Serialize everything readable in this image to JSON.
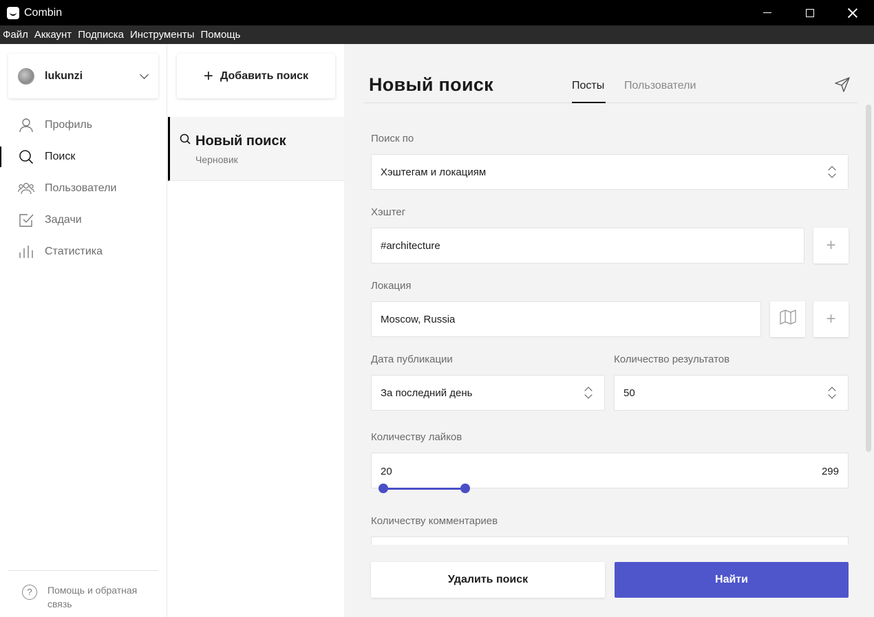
{
  "window": {
    "title": "Combin"
  },
  "menu": {
    "items": [
      "Файл",
      "Аккаунт",
      "Подписка",
      "Инструменты",
      "Помощь"
    ]
  },
  "sidebar": {
    "account_name": "lukunzi",
    "items": [
      {
        "label": "Профиль",
        "icon": "user-icon"
      },
      {
        "label": "Поиск",
        "icon": "search-icon"
      },
      {
        "label": "Пользователи",
        "icon": "users-icon"
      },
      {
        "label": "Задачи",
        "icon": "tasks-icon"
      },
      {
        "label": "Статистика",
        "icon": "stats-icon"
      }
    ],
    "active_index": 1,
    "help_label": "Помощь и обратная связь"
  },
  "searches": {
    "add_label": "Добавить поиск",
    "items": [
      {
        "title": "Новый поиск",
        "status": "Черновик"
      }
    ]
  },
  "main": {
    "title": "Новый поиск",
    "tabs": [
      {
        "label": "Посты",
        "active": true
      },
      {
        "label": "Пользователи",
        "active": false
      }
    ],
    "form": {
      "search_by_label": "Поиск по",
      "search_by_value": "Хэштегам и локациям",
      "hashtag_label": "Хэштег",
      "hashtag_value": "#architecture",
      "location_label": "Локация",
      "location_value": "Moscow, Russia",
      "date_label": "Дата публикации",
      "date_value": "За последний день",
      "results_label": "Количество результатов",
      "results_value": "50",
      "likes_label": "Количеству лайков",
      "likes_min": "20",
      "likes_max": "299",
      "comments_label": "Количеству комментариев"
    },
    "delete_label": "Удалить поиск",
    "find_label": "Найти"
  },
  "colors": {
    "accent": "#4f56cc",
    "slider": "#4a4fc6"
  }
}
